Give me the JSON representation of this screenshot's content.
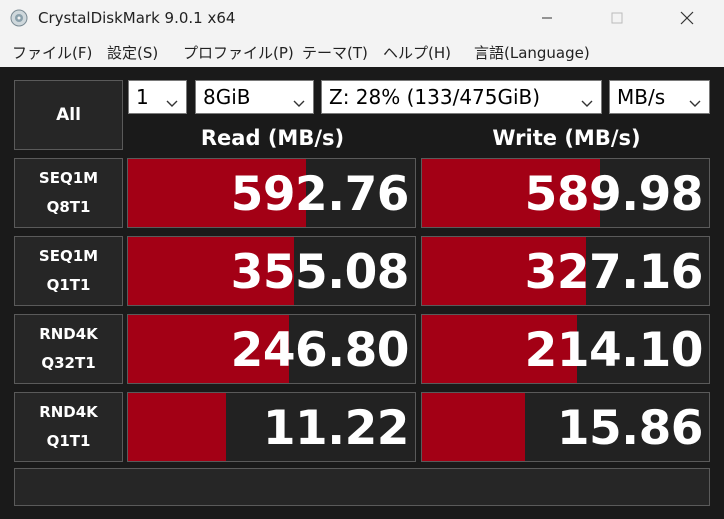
{
  "window": {
    "title": "CrystalDiskMark 9.0.1 x64",
    "icon": "crystaldiskmark-app-icon",
    "controls": [
      "minimize-icon",
      "maximize-icon",
      "close-icon"
    ]
  },
  "menu": [
    "ファイル(F)",
    "設定(S)",
    "プロファイル(P)",
    "テーマ(T)",
    "ヘルプ(H)",
    "言語(Language)"
  ],
  "all_label": "All",
  "controls": {
    "count": "1",
    "size": "8GiB",
    "drive": "Z: 28% (133/475GiB)",
    "unit": "MB/s"
  },
  "headers": {
    "read": "Read (MB/s)",
    "write": "Write (MB/s)"
  },
  "tests": [
    {
      "line1": "SEQ1M",
      "line2": "Q8T1",
      "read": "592.76",
      "write": "589.98",
      "read_fill": 0.62,
      "write_fill": 0.62
    },
    {
      "line1": "SEQ1M",
      "line2": "Q1T1",
      "read": "355.08",
      "write": "327.16",
      "read_fill": 0.58,
      "write_fill": 0.57
    },
    {
      "line1": "RND4K",
      "line2": "Q32T1",
      "read": "246.80",
      "write": "214.10",
      "read_fill": 0.56,
      "write_fill": 0.54
    },
    {
      "line1": "RND4K",
      "line2": "Q1T1",
      "read": "11.22",
      "write": "15.86",
      "read_fill": 0.34,
      "write_fill": 0.36
    }
  ],
  "comment": "",
  "colors": {
    "bar": "#a30015",
    "panel": "#1a1a1a",
    "cell": "#222222",
    "border": "#5a5a5a"
  }
}
